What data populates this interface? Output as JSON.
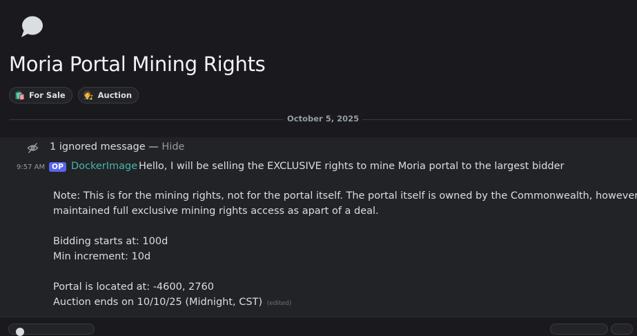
{
  "thread": {
    "title": "Moria Portal Mining Rights",
    "icon": "thread-bubble-icon",
    "tags": [
      {
        "emoji": "🛍️",
        "label": "For Sale"
      },
      {
        "emoji": "🧑‍⚖️",
        "label": "Auction"
      }
    ]
  },
  "divider": {
    "date": "October 5, 2025"
  },
  "ignored": {
    "text": "1 ignored message — ",
    "hide_label": "Hide"
  },
  "message": {
    "time": "9:57 AM",
    "badge": "OP",
    "author": "DockerImage",
    "author_color": "#46b6a8",
    "lines": [
      "Hello, I will be selling the EXCLUSIVE rights to mine Moria portal to the largest bidder",
      "Note: This is for the mining rights, not for the portal itself. The portal itself is owned by the Commonwealth, however I've",
      "maintained full exclusive mining rights access as apart of a deal.",
      "Bidding starts at: 100d",
      "Min increment: 10d",
      "Portal is located at: -4600, 2760",
      "Auction ends on 10/10/25 (Midnight, CST)"
    ],
    "edited_label": "(edited)"
  },
  "colors": {
    "background": "#1a1a1e",
    "message_area": "#222327",
    "op_badge": "#5865f2",
    "muted_text": "#949ba4"
  }
}
